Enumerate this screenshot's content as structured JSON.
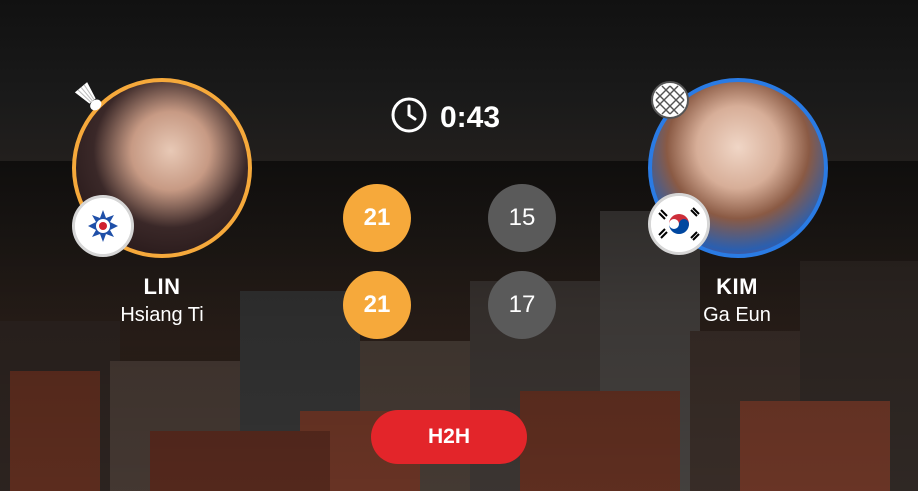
{
  "timer": {
    "elapsed": "0:43",
    "icon": "clock-icon"
  },
  "player1": {
    "last_name": "LIN",
    "first_name": "Hsiang Ti",
    "ring_color": "#f6a93b",
    "flag_icon": "chinese-taipei-flag-icon",
    "status_icon": "shuttlecock-icon"
  },
  "player2": {
    "last_name": "KIM",
    "first_name": "Ga Eun",
    "ring_color": "#2a7be4",
    "flag_icon": "south-korea-flag-icon",
    "status_icon": "racket-icon"
  },
  "games": [
    {
      "p1": "21",
      "p2": "15"
    },
    {
      "p1": "21",
      "p2": "17"
    }
  ],
  "colors": {
    "winner_score": "#f6a93b",
    "loser_score": "#5a5a5a",
    "h2h_button": "#e3252a"
  },
  "h2h_label": "H2H"
}
